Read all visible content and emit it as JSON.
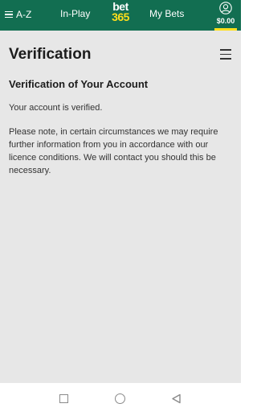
{
  "topbar": {
    "az_label": "A-Z",
    "inplay_label": "In-Play",
    "logo_line1": "bet",
    "logo_line2": "365",
    "mybets_label": "My Bets",
    "balance": "$0.00"
  },
  "page": {
    "title": "Verification"
  },
  "content": {
    "heading": "Verification of Your Account",
    "status": "Your account is verified.",
    "note": "Please note, in certain circumstances we may require further information from you in accordance with our licence conditions. We will contact you should this be necessary."
  },
  "icons": {
    "az": "hamburger-icon",
    "account": "user-icon",
    "page_menu": "hamburger-icon",
    "recents": "square-icon",
    "home": "circle-icon",
    "back": "triangle-back-icon"
  },
  "colors": {
    "header_bg": "#126e51",
    "brand_yellow": "#ffdf1b",
    "content_bg": "#e7e7e7"
  }
}
